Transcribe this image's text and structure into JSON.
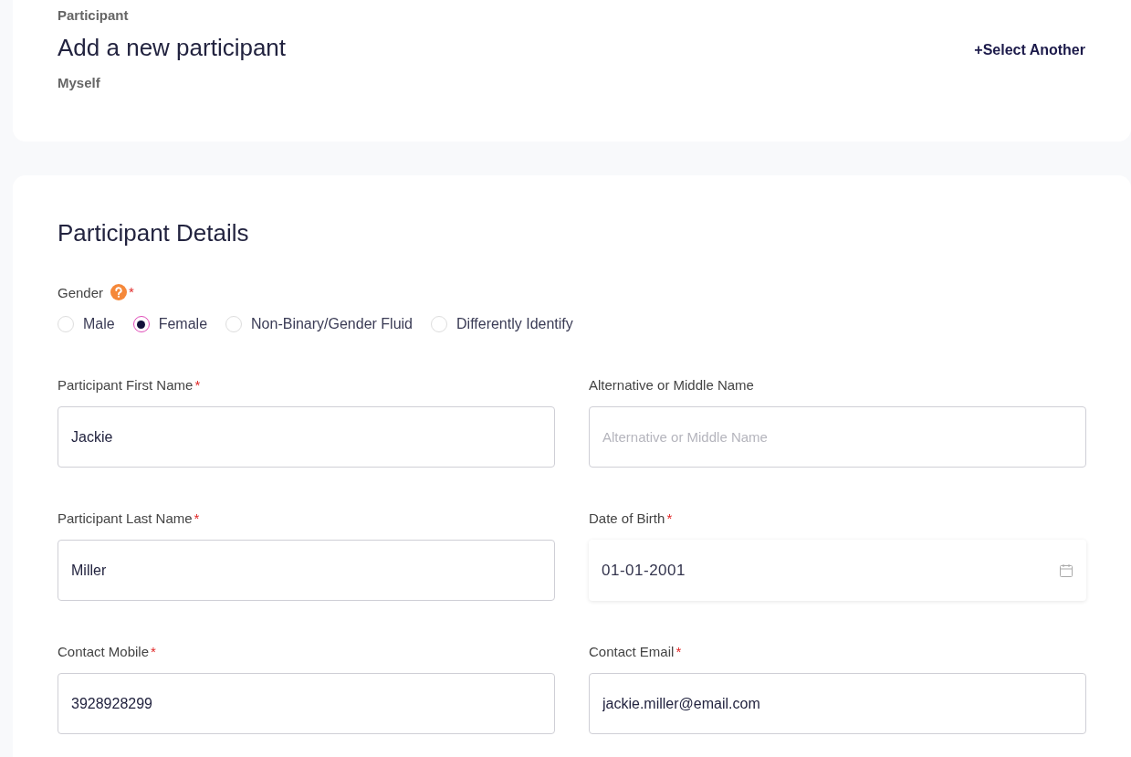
{
  "header": {
    "eyebrow": "Participant",
    "title": "Add a new participant",
    "subtitle": "Myself",
    "action": "+Select Another"
  },
  "details": {
    "title": "Participant Details",
    "gender": {
      "label": "Gender",
      "required_mark": "*",
      "options": [
        {
          "label": "Male",
          "selected": false
        },
        {
          "label": "Female",
          "selected": true
        },
        {
          "label": "Non-Binary/Gender Fluid",
          "selected": false
        },
        {
          "label": "Differently Identify",
          "selected": false
        }
      ]
    },
    "fields": [
      {
        "kind": "text",
        "label": "Participant First Name",
        "required_mark": "*",
        "value": "Jackie"
      },
      {
        "kind": "text",
        "label": "Alternative or Middle Name",
        "placeholder": "Alternative or Middle Name"
      },
      {
        "kind": "text",
        "label": "Participant Last Name",
        "required_mark": "*",
        "value": "Miller"
      },
      {
        "kind": "date",
        "label": "Date of Birth",
        "required_mark": "*",
        "value": "01-01-2001"
      },
      {
        "kind": "text",
        "label": "Contact Mobile",
        "required_mark": "*",
        "value": "3928928299"
      },
      {
        "kind": "text",
        "label": "Contact Email",
        "required_mark": "*",
        "value": "jackie.miller@email.com"
      }
    ]
  }
}
